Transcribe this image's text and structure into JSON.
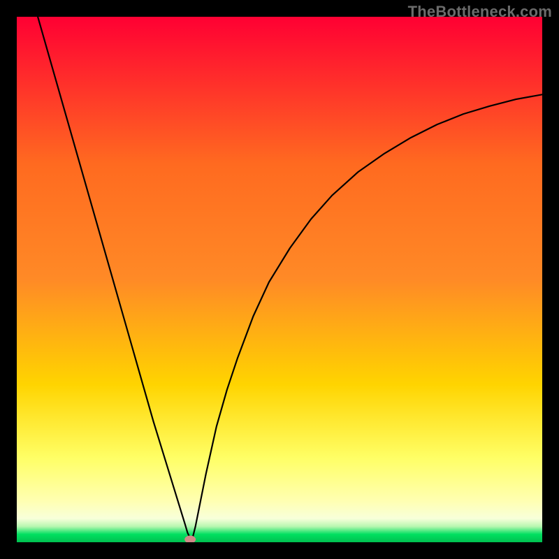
{
  "watermark": "TheBottleneck.com",
  "chart_data": {
    "type": "line",
    "title": "",
    "xlabel": "",
    "ylabel": "",
    "xlim": [
      0,
      100
    ],
    "ylim": [
      0,
      100
    ],
    "series": [
      {
        "name": "bottleneck-curve",
        "x": [
          4,
          6,
          8,
          10,
          12,
          14,
          16,
          18,
          20,
          22,
          24,
          26,
          28,
          30,
          32,
          32.5,
          33.2,
          33.5,
          34,
          35,
          36,
          38,
          40,
          42,
          45,
          48,
          52,
          56,
          60,
          65,
          70,
          75,
          80,
          85,
          90,
          95,
          100
        ],
        "y": [
          100,
          93,
          86,
          79,
          72,
          65,
          58,
          51,
          44,
          37,
          30,
          23,
          16.5,
          10,
          3.5,
          1.8,
          0.4,
          1,
          3,
          8,
          13,
          22,
          29,
          35,
          43,
          49.5,
          56,
          61.5,
          66,
          70.5,
          74,
          77,
          79.5,
          81.5,
          83,
          84.3,
          85.2
        ]
      }
    ],
    "marker": {
      "name": "min-point",
      "x": 33,
      "y": 0,
      "color": "#d08a88"
    },
    "background_gradient": {
      "top": "#ff0033",
      "mid_upper": "#ff8a26",
      "mid": "#ffd400",
      "mid_lower": "#ffff66",
      "lower": "#ffffb0",
      "base_green": "#00e060",
      "bottom": "#00c050"
    }
  }
}
